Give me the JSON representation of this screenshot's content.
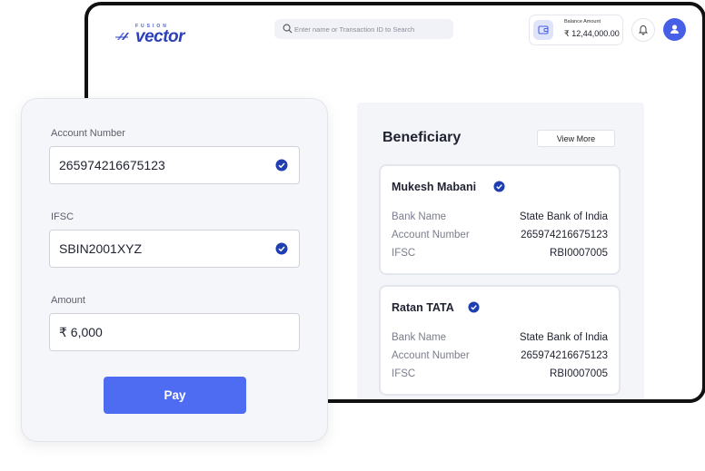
{
  "header": {
    "logo_top": "FUSION",
    "logo_word": "vector",
    "search_placeholder": "Enter name or Transaction ID to Search",
    "balance_label": "Balance Amount",
    "balance_value": "₹ 12,44,000.00"
  },
  "beneficiary": {
    "title": "Beneficiary",
    "view_more": "View More",
    "cards": [
      {
        "name": "Mukesh Mabani",
        "rows": [
          {
            "label": "Bank Name",
            "value": "State Bank of India"
          },
          {
            "label": "Account Number",
            "value": "265974216675123"
          },
          {
            "label": "IFSC",
            "value": "RBI0007005"
          }
        ]
      },
      {
        "name": "Ratan TATA",
        "rows": [
          {
            "label": "Bank Name",
            "value": "State Bank of India"
          },
          {
            "label": "Account Number",
            "value": "265974216675123"
          },
          {
            "label": "IFSC",
            "value": "RBI0007005"
          }
        ]
      }
    ]
  },
  "payment": {
    "account_label": "Account Number",
    "account_value": "265974216675123",
    "ifsc_label": "IFSC",
    "ifsc_value": "SBIN2001XYZ",
    "amount_label": "Amount",
    "amount_value": "₹ 6,000",
    "pay_label": "Pay"
  },
  "colors": {
    "accent": "#4e6cf2",
    "verified": "#1f3fb0",
    "panel": "#f4f5f9"
  },
  "icons": [
    "search-icon",
    "wallet-icon",
    "bell-icon",
    "user-icon",
    "verified-check-icon"
  ]
}
